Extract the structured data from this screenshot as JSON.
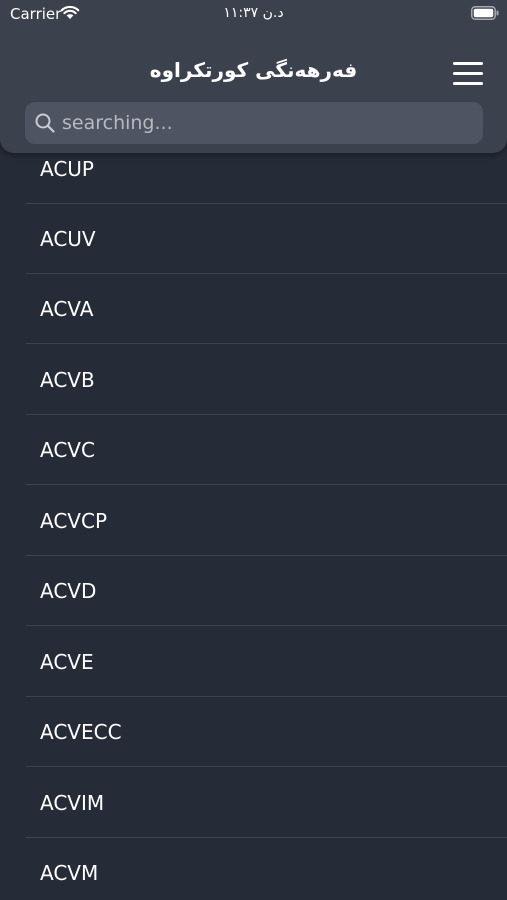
{
  "status_bar": {
    "carrier": "Carrier",
    "time": "د.ن ١١:٣٧",
    "wifi_icon": "wifi-icon",
    "battery_icon": "battery-icon"
  },
  "header": {
    "title": "فەرهەنگی کورتکراوە",
    "menu_icon": "hamburger-menu-icon"
  },
  "search": {
    "placeholder": "searching...",
    "value": "",
    "icon": "search-icon"
  },
  "colors": {
    "background": "#252b37",
    "header": "#3b414d",
    "search_field": "#4e5461",
    "separator": "#3e4450",
    "text": "#ffffff"
  },
  "list": {
    "items": [
      {
        "label": "ACUP"
      },
      {
        "label": "ACUV"
      },
      {
        "label": "ACVA"
      },
      {
        "label": "ACVB"
      },
      {
        "label": "ACVC"
      },
      {
        "label": "ACVCP"
      },
      {
        "label": "ACVD"
      },
      {
        "label": "ACVE"
      },
      {
        "label": "ACVECC"
      },
      {
        "label": "ACVIM"
      },
      {
        "label": "ACVM"
      }
    ]
  }
}
